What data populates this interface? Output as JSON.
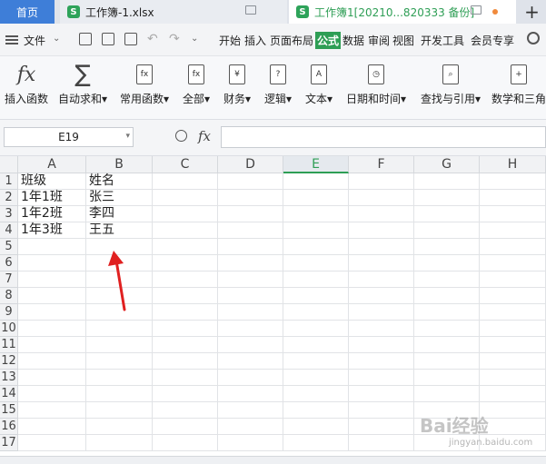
{
  "tabbar": {
    "home": "首页",
    "tabs": [
      {
        "title": "工作簿-1.xlsx",
        "active": false
      },
      {
        "title": "工作簿1[20210...820333 备份]",
        "active": true
      }
    ],
    "new_tab": "+"
  },
  "menu": {
    "file": "文件",
    "tabs": [
      "开始",
      "插入",
      "页面布局",
      "公式",
      "数据",
      "审阅",
      "视图",
      "开发工具",
      "会员专享"
    ],
    "active_tab": "公式"
  },
  "ribbon": {
    "buttons": [
      {
        "label": "插入函数",
        "icon": "fx-icon",
        "glyph": "fx"
      },
      {
        "label": "自动求和",
        "icon": "sigma-icon",
        "glyph": "∑",
        "dropdown": true
      },
      {
        "label": "常用函数",
        "icon": "star-function-icon",
        "glyph": "fx",
        "dropdown": true
      },
      {
        "label": "全部",
        "icon": "all-functions-icon",
        "glyph": "fx",
        "dropdown": true
      },
      {
        "label": "财务",
        "icon": "finance-icon",
        "glyph": "¥",
        "dropdown": true
      },
      {
        "label": "逻辑",
        "icon": "logic-icon",
        "glyph": "?",
        "dropdown": true
      },
      {
        "label": "文本",
        "icon": "text-icon",
        "glyph": "A",
        "dropdown": true
      },
      {
        "label": "日期和时间",
        "icon": "clock-icon",
        "glyph": "◷",
        "dropdown": true
      },
      {
        "label": "查找与引用",
        "icon": "lookup-icon",
        "glyph": "⌕",
        "dropdown": true
      },
      {
        "label": "数学和三角",
        "icon": "math-icon",
        "glyph": "+",
        "dropdown": false
      }
    ]
  },
  "formula_bar": {
    "name_box": "E19",
    "fx": "fx",
    "value": ""
  },
  "sheet": {
    "columns": [
      "A",
      "B",
      "C",
      "D",
      "E",
      "F",
      "G",
      "H"
    ],
    "selected_column": "E",
    "rows": [
      "1",
      "2",
      "3",
      "4",
      "5",
      "6",
      "7",
      "8",
      "9",
      "10",
      "11",
      "12",
      "13",
      "14",
      "15",
      "16",
      "17"
    ],
    "cells": [
      [
        "班级",
        "姓名"
      ],
      [
        "1年1班",
        "张三"
      ],
      [
        "1年2班",
        "李四"
      ],
      [
        "1年3班",
        "王五"
      ]
    ]
  },
  "annotation": {
    "arrow_color": "#e02020"
  },
  "watermark": {
    "text": "Bai经验",
    "sub": "jingyan.baidu.com"
  },
  "colors": {
    "accent_green": "#2e9e55",
    "home_blue": "#3e7ed8"
  }
}
